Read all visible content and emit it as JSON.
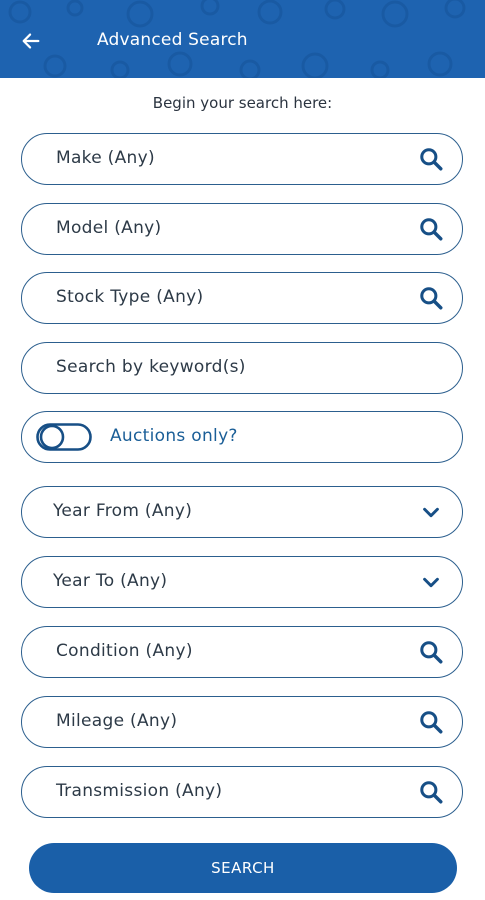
{
  "app_bar": {
    "title": "Advanced Search",
    "back_icon": "arrow-left-icon",
    "background_color": "#1e63b0"
  },
  "intro_text": "Begin your search here:",
  "fields": {
    "make": {
      "label": "Make (Any)",
      "icon": "search-icon"
    },
    "model": {
      "label": "Model (Any)",
      "icon": "search-icon"
    },
    "stock_type": {
      "label": "Stock Type (Any)",
      "icon": "search-icon"
    },
    "keyword": {
      "placeholder": "Search by keyword(s)"
    },
    "auctions_only": {
      "label": "Auctions only?",
      "checked": false
    },
    "year_from": {
      "label": "Year From (Any)",
      "icon": "chevron-down-icon"
    },
    "year_to": {
      "label": "Year To (Any)",
      "icon": "chevron-down-icon"
    },
    "condition": {
      "label": "Condition (Any)",
      "icon": "search-icon"
    },
    "mileage": {
      "label": "Mileage (Any)",
      "icon": "search-icon"
    },
    "transmission": {
      "label": "Transmission (Any)",
      "icon": "search-icon"
    }
  },
  "search_button": {
    "label": "SEARCH"
  },
  "colors": {
    "accent": "#1a5fa8",
    "border": "#2c5f8e",
    "icon": "#174f86"
  }
}
